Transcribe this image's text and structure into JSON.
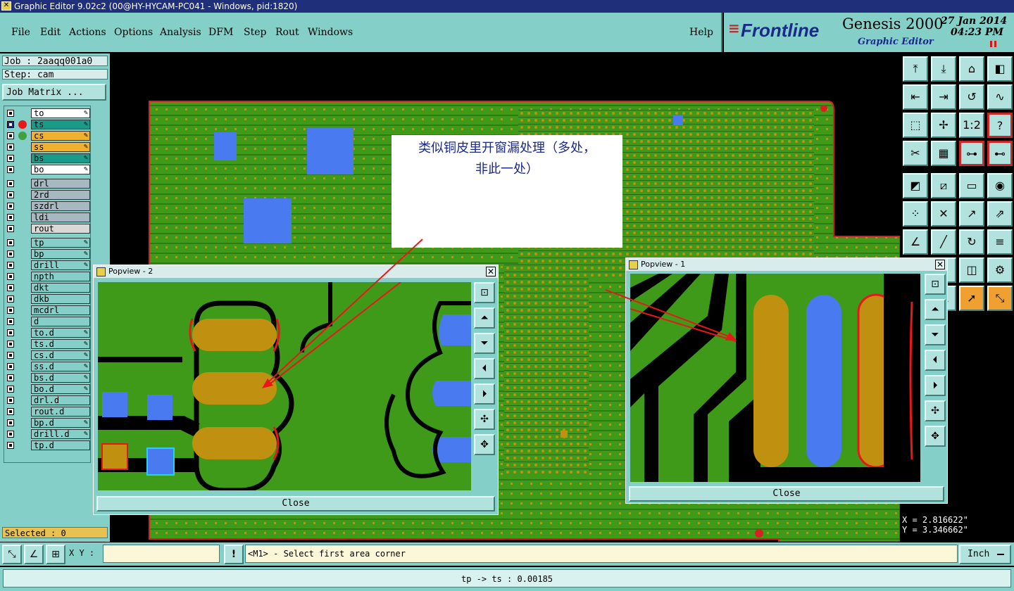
{
  "window": {
    "title": "Graphic Editor 9.02c2 (00@HY-HYCAM-PC041 - Windows, pid:1820)"
  },
  "menu": {
    "items": [
      "File",
      "Edit",
      "Actions",
      "Options",
      "Analysis",
      "DFM",
      "Step",
      "Rout",
      "Windows"
    ],
    "help": "Help"
  },
  "brand": {
    "logo": "Frontline",
    "product": "Genesis 2000",
    "subtitle": "Graphic Editor",
    "date": "27 Jan 2014",
    "time": "04:23 PM"
  },
  "job": {
    "job_label": "Job : 2aaqq001a0",
    "step_label": "Step: cam",
    "matrix_button": "Job Matrix ..."
  },
  "layers": [
    {
      "name": "to",
      "color": "#ffffff",
      "checked": false,
      "dot": "",
      "editable": true
    },
    {
      "name": "ts",
      "color": "#1b9a8a",
      "checked": true,
      "dot": "#e81818",
      "editable": true
    },
    {
      "name": "cs",
      "color": "#f0b030",
      "checked": false,
      "dot": "#40a040",
      "editable": true
    },
    {
      "name": "ss",
      "color": "#f0b030",
      "checked": false,
      "dot": "",
      "editable": true
    },
    {
      "name": "bs",
      "color": "#1b9a8a",
      "checked": false,
      "dot": "",
      "editable": true
    },
    {
      "name": "bo",
      "color": "#ffffff",
      "checked": false,
      "dot": "",
      "editable": true
    },
    {
      "name": "drl",
      "color": "#a8b8c0",
      "checked": false,
      "dot": "",
      "editable": false
    },
    {
      "name": "2rd",
      "color": "#a8b8c0",
      "checked": false,
      "dot": "",
      "editable": false
    },
    {
      "name": "szdrl",
      "color": "#a8b8c0",
      "checked": false,
      "dot": "",
      "editable": false
    },
    {
      "name": "ldi",
      "color": "#a8b8c0",
      "checked": false,
      "dot": "",
      "editable": false
    },
    {
      "name": "rout",
      "color": "#d8d8d8",
      "checked": false,
      "dot": "",
      "editable": false
    },
    {
      "name": "tp",
      "color": "#84cfc8",
      "checked": false,
      "dot": "",
      "editable": true
    },
    {
      "name": "bp",
      "color": "#84cfc8",
      "checked": false,
      "dot": "",
      "editable": true
    },
    {
      "name": "drill",
      "color": "#84cfc8",
      "checked": false,
      "dot": "",
      "editable": true
    },
    {
      "name": "npth",
      "color": "#84cfc8",
      "checked": false,
      "dot": "",
      "editable": false
    },
    {
      "name": "dkt",
      "color": "#84cfc8",
      "checked": false,
      "dot": "",
      "editable": false
    },
    {
      "name": "dkb",
      "color": "#84cfc8",
      "checked": false,
      "dot": "",
      "editable": false
    },
    {
      "name": "mcdrl",
      "color": "#84cfc8",
      "checked": false,
      "dot": "",
      "editable": false
    },
    {
      "name": "d",
      "color": "#84cfc8",
      "checked": false,
      "dot": "",
      "editable": false
    },
    {
      "name": "to.d",
      "color": "#84cfc8",
      "checked": false,
      "dot": "",
      "editable": true
    },
    {
      "name": "ts.d",
      "color": "#84cfc8",
      "checked": false,
      "dot": "",
      "editable": true
    },
    {
      "name": "cs.d",
      "color": "#84cfc8",
      "checked": false,
      "dot": "",
      "editable": true
    },
    {
      "name": "ss.d",
      "color": "#84cfc8",
      "checked": false,
      "dot": "",
      "editable": true
    },
    {
      "name": "bs.d",
      "color": "#84cfc8",
      "checked": false,
      "dot": "",
      "editable": true
    },
    {
      "name": "bo.d",
      "color": "#84cfc8",
      "checked": false,
      "dot": "",
      "editable": true
    },
    {
      "name": "drl.d",
      "color": "#84cfc8",
      "checked": false,
      "dot": "",
      "editable": false
    },
    {
      "name": "rout.d",
      "color": "#84cfc8",
      "checked": false,
      "dot": "",
      "editable": false
    },
    {
      "name": "bp.d",
      "color": "#84cfc8",
      "checked": false,
      "dot": "",
      "editable": true
    },
    {
      "name": "drill.d",
      "color": "#84cfc8",
      "checked": false,
      "dot": "",
      "editable": true
    },
    {
      "name": "tp.d",
      "color": "#84cfc8",
      "checked": false,
      "dot": "",
      "editable": false
    }
  ],
  "selected": "Selected : 0",
  "annotation": {
    "line1": "类似铜皮里开窗漏处理（多处，",
    "line2": "非此一处）"
  },
  "popview2": {
    "title": "Popview - 2",
    "close": "Close"
  },
  "popview1": {
    "title": "Popview - 1",
    "close": "Close"
  },
  "coords": {
    "x": "X = 2.816622\"",
    "y": "Y = 3.346662\""
  },
  "input": {
    "xy_label": "X Y :",
    "xy_value": "",
    "prompt": "<M1> - Select first area corner",
    "units": "Inch"
  },
  "status": "tp -> ts : 0.00185",
  "colors": {
    "panel": "#84cfc8",
    "board": "#3f9a1a",
    "pad": "#c09010",
    "blue": "#4a7af0",
    "red": "#e81818"
  }
}
